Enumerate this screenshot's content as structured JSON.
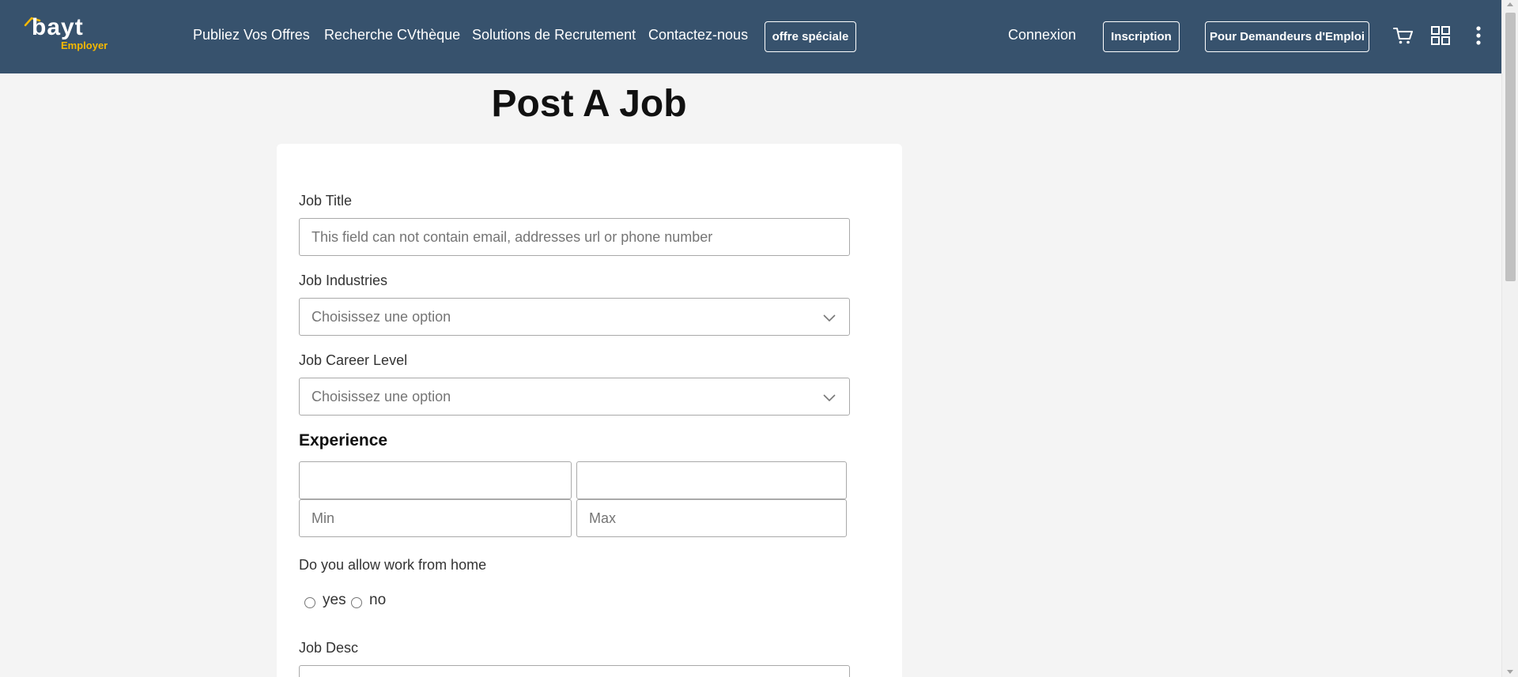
{
  "header": {
    "logo_text": "bayt",
    "logo_sub": "Employer",
    "nav": [
      "Publiez Vos Offres",
      "Recherche CVthèque",
      "Solutions de Recrutement",
      "Contactez-nous"
    ],
    "special_offer": "offre spéciale",
    "login": "Connexion",
    "signup": "Inscription",
    "job_seekers": "Pour Demandeurs d'Emploi",
    "icons": [
      "cart-icon",
      "apps-grid-icon",
      "more-vertical-icon"
    ]
  },
  "page": {
    "title": "Post A Job"
  },
  "form": {
    "job_title": {
      "label": "Job Title",
      "placeholder": "This field can not contain email, addresses url or phone number",
      "value": ""
    },
    "job_industries": {
      "label": "Job Industries",
      "selected": "Choisissez une option"
    },
    "job_career_level": {
      "label": "Job Career Level",
      "selected": "Choisissez une option"
    },
    "experience": {
      "heading": "Experience",
      "min_placeholder": "Min",
      "max_placeholder": "Max"
    },
    "work_from_home": {
      "label": "Do you allow work from home",
      "options": [
        "yes",
        "no"
      ]
    },
    "job_desc": {
      "label": "Job Desc"
    }
  },
  "colors": {
    "header_bg": "#37526d",
    "brand_accent": "#f5b800",
    "page_bg": "#f4f4f4"
  }
}
